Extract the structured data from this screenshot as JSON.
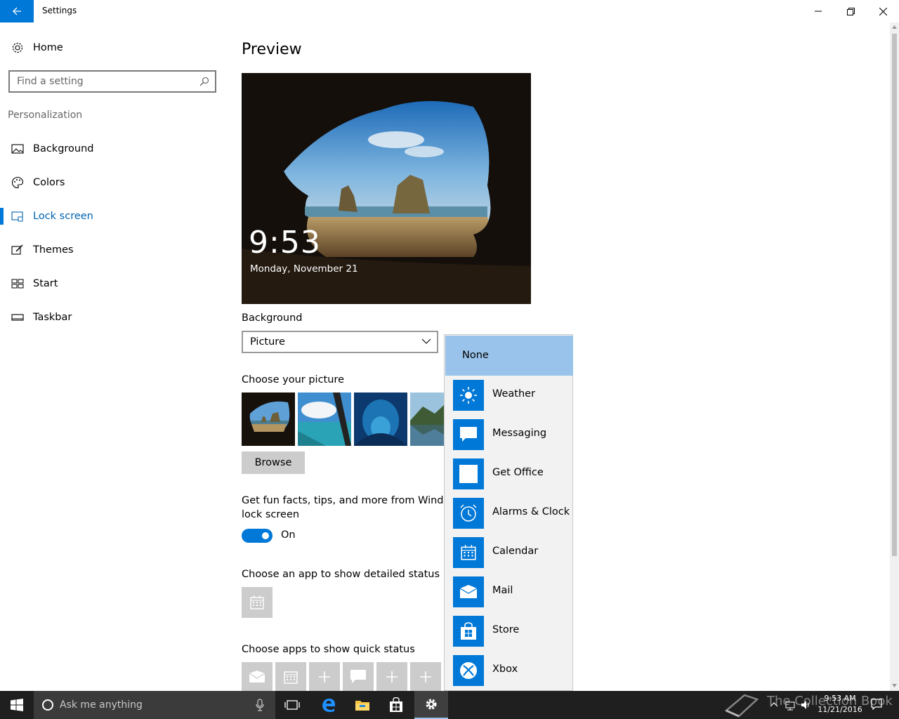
{
  "window": {
    "title": "Settings"
  },
  "sidebar": {
    "home_label": "Home",
    "search_placeholder": "Find a setting",
    "section": "Personalization",
    "items": [
      {
        "label": "Background",
        "icon": "picture-icon"
      },
      {
        "label": "Colors",
        "icon": "palette-icon"
      },
      {
        "label": "Lock screen",
        "icon": "lock-screen-icon",
        "active": true
      },
      {
        "label": "Themes",
        "icon": "brush-icon"
      },
      {
        "label": "Start",
        "icon": "start-grid-icon"
      },
      {
        "label": "Taskbar",
        "icon": "taskbar-icon"
      }
    ]
  },
  "main": {
    "preview_title": "Preview",
    "preview_time": "9:53",
    "preview_date": "Monday, November 21",
    "background_label": "Background",
    "background_value": "Picture",
    "choose_picture_label": "Choose your picture",
    "browse_label": "Browse",
    "fun_facts_label_1": "Get fun facts, tips, and more from Windows",
    "fun_facts_label_2": "lock screen",
    "toggle_state": "On",
    "detailed_status_label": "Choose an app to show detailed status",
    "quick_status_label": "Choose apps to show quick status"
  },
  "flyout": {
    "selected": "None",
    "items": [
      {
        "label": "Weather",
        "icon": "sun-icon"
      },
      {
        "label": "Messaging",
        "icon": "chat-bubble-icon"
      },
      {
        "label": "Get Office",
        "icon": "office-icon"
      },
      {
        "label": "Alarms & Clock",
        "icon": "alarm-clock-icon"
      },
      {
        "label": "Calendar",
        "icon": "calendar-icon"
      },
      {
        "label": "Mail",
        "icon": "envelope-icon"
      },
      {
        "label": "Store",
        "icon": "store-bag-icon"
      },
      {
        "label": "Xbox",
        "icon": "xbox-icon"
      }
    ]
  },
  "taskbar": {
    "search_text": "Ask me anything",
    "time": "9:53 AM",
    "date": "11/21/2016",
    "watermark": "The Collection Book"
  },
  "colors": {
    "accent": "#0078d7",
    "flyout_selected": "#99c3ea",
    "taskbar": "#1f1f1f"
  }
}
